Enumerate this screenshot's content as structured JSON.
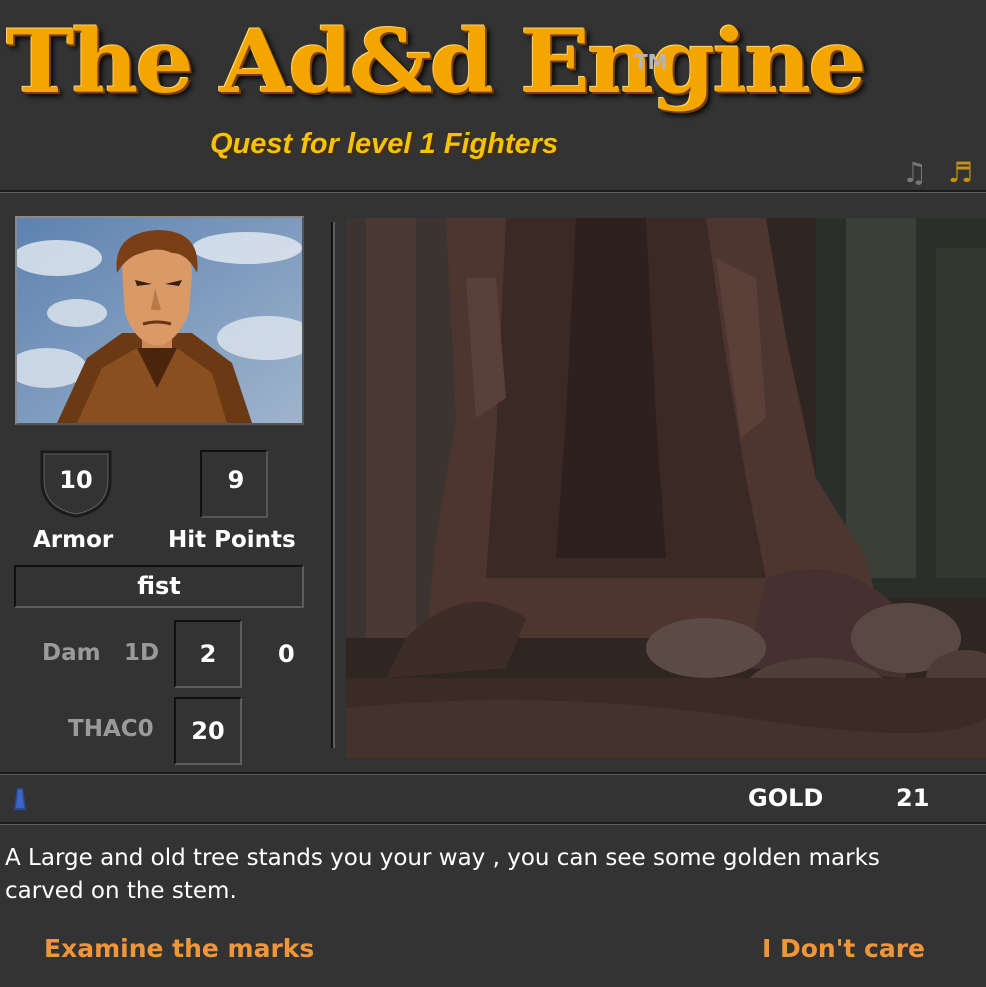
{
  "header": {
    "title": "The Ad&d Engine",
    "trademark": "TM",
    "subtitle": "Quest for level 1 Fighters"
  },
  "audio": {
    "music_off_icon": "music-note-grey-icon",
    "music_on_icon": "music-note-gold-icon",
    "music_off_glyph": "♫",
    "music_on_glyph": "♬"
  },
  "character": {
    "portrait": "fighter-portrait",
    "armor_value": "10",
    "armor_label": "Armor",
    "hp_value": "9",
    "hp_label": "Hit Points",
    "weapon": "fist",
    "damage_label": "Dam",
    "damage_die": "1D",
    "damage_value": "2",
    "damage_bonus": "0",
    "thaco_label": "THAC0",
    "thaco_value": "20"
  },
  "status": {
    "gold_label": "GOLD",
    "gold_value": "21"
  },
  "story": {
    "text": "A Large and old tree stands you your way , you can see some golden marks carved on the stem.",
    "choices": [
      {
        "label": "Examine the marks"
      },
      {
        "label": "I Don't care"
      }
    ]
  },
  "colors": {
    "background": "#333333",
    "logo": "#f4a500",
    "subtitle": "#f5c400",
    "choice": "#f0963a",
    "muted_label": "#9a9a9a"
  }
}
